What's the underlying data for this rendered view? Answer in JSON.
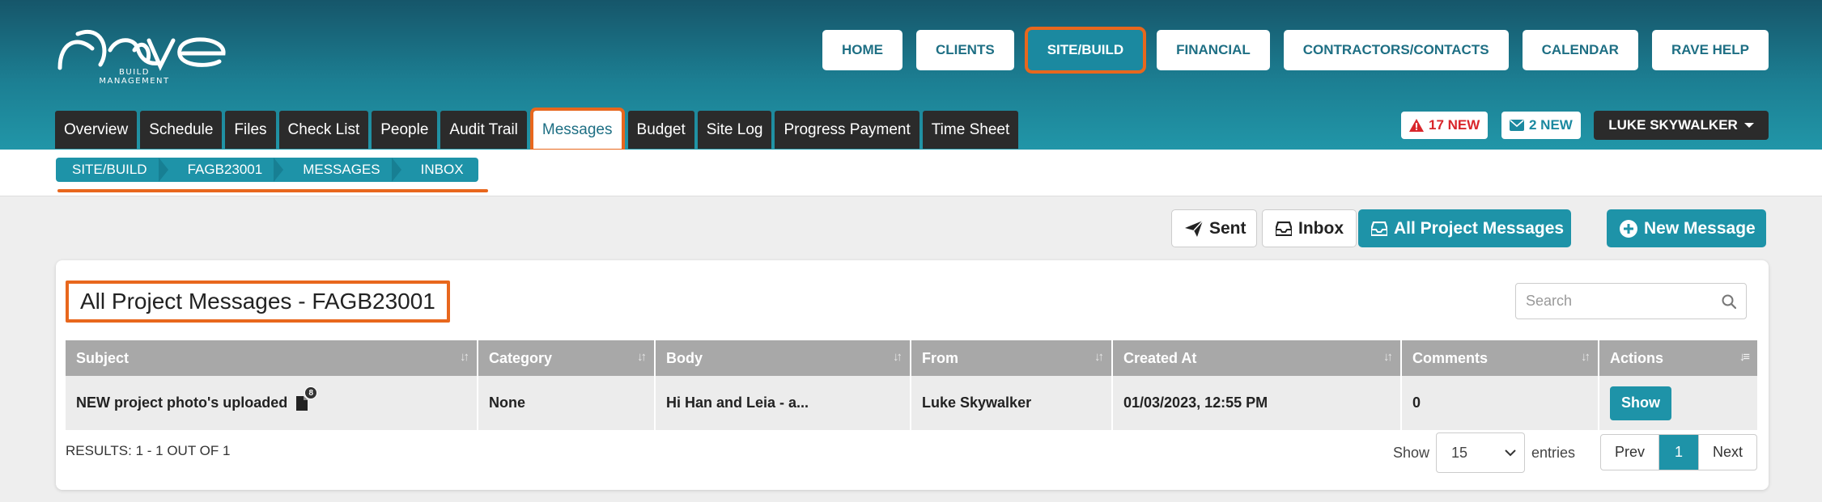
{
  "brand": {
    "logo_text": "rave",
    "tagline": "BUILD MANAGEMENT"
  },
  "main_nav": [
    {
      "label": "HOME",
      "active": false
    },
    {
      "label": "CLIENTS",
      "active": false
    },
    {
      "label": "SITE/BUILD",
      "active": true
    },
    {
      "label": "FINANCIAL",
      "active": false
    },
    {
      "label": "CONTRACTORS/CONTACTS",
      "active": false
    },
    {
      "label": "CALENDAR",
      "active": false
    },
    {
      "label": "RAVE HELP",
      "active": false
    }
  ],
  "tabs": [
    {
      "label": "Overview"
    },
    {
      "label": "Schedule"
    },
    {
      "label": "Files"
    },
    {
      "label": "Check List"
    },
    {
      "label": "People"
    },
    {
      "label": "Audit Trail"
    },
    {
      "label": "Messages",
      "active": true
    },
    {
      "label": "Budget"
    },
    {
      "label": "Site Log"
    },
    {
      "label": "Progress Payment"
    },
    {
      "label": "Time Sheet"
    }
  ],
  "alerts": {
    "warnings": "17 NEW",
    "messages": "2 NEW"
  },
  "user": {
    "name": "LUKE SKYWALKER"
  },
  "breadcrumb": [
    "SITE/BUILD",
    "FAGB23001",
    "MESSAGES",
    "INBOX"
  ],
  "toolbar": {
    "sent_label": "Sent",
    "inbox_label": "Inbox",
    "all_label": "All Project Messages",
    "new_label": "New Message"
  },
  "card": {
    "title": "All Project Messages - FAGB23001",
    "search_placeholder": "Search"
  },
  "table": {
    "columns": [
      "Subject",
      "Category",
      "Body",
      "From",
      "Created At",
      "Comments",
      "Actions"
    ],
    "rows": [
      {
        "subject": "NEW project photo's uploaded",
        "attachments": "8",
        "category": "None",
        "body": "Hi Han and Leia - a...",
        "from": "Luke Skywalker",
        "created_at": "01/03/2023, 12:55 PM",
        "comments": "0",
        "action": "Show"
      }
    ]
  },
  "footer": {
    "results": "RESULTS: 1 - 1 OUT OF 1",
    "show_label": "Show",
    "entries_value": "15",
    "entries_label": "entries",
    "prev": "Prev",
    "page": "1",
    "next": "Next"
  },
  "colors": {
    "teal": "#1e93a8",
    "highlight": "#e8671d",
    "dark": "#2b2b2b"
  }
}
